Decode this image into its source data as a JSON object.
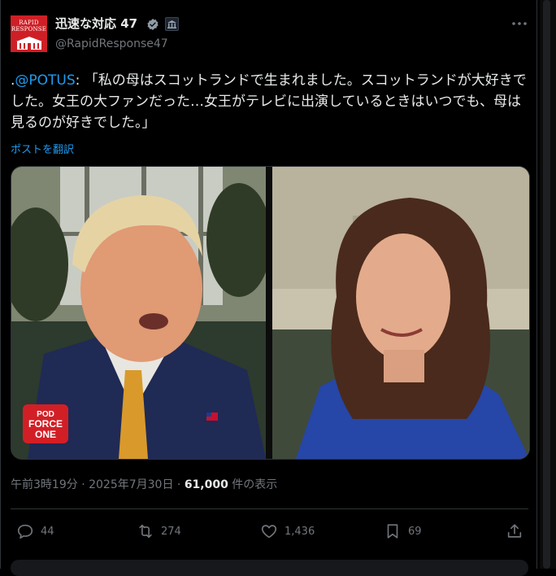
{
  "account": {
    "name": "迅速な対応 47",
    "handle": "@RapidResponse47",
    "avatar_text": "RAPID\nRESPONSE"
  },
  "tweet": {
    "prefix": ".",
    "mention": "@POTUS",
    "text": ": 「私の母はスコットランドで生まれました。スコットランドが大好きでした。女王の大ファンだった…女王がテレビに出演しているときはいつでも、母は見るのが好きでした。」",
    "translate_label": "ポストを翻訳",
    "video_watermark": [
      "POD",
      "FORCE",
      "ONE"
    ]
  },
  "meta": {
    "time": "午前3時19分",
    "separator": "·",
    "date": "2025年7月30日",
    "views_count": "61,000",
    "views_label": "件の表示"
  },
  "actions": {
    "replies": "44",
    "reposts": "274",
    "likes": "1,436",
    "bookmarks": "69"
  },
  "colors": {
    "background": "#000000",
    "text": "#e7e9ea",
    "muted": "#71767b",
    "accent": "#1d9bf0",
    "brand_red": "#cf1f26"
  },
  "icons": [
    "verified-badge-icon",
    "government-badge-icon",
    "more-icon",
    "reply-icon",
    "repost-icon",
    "like-icon",
    "bookmark-icon",
    "share-icon"
  ]
}
